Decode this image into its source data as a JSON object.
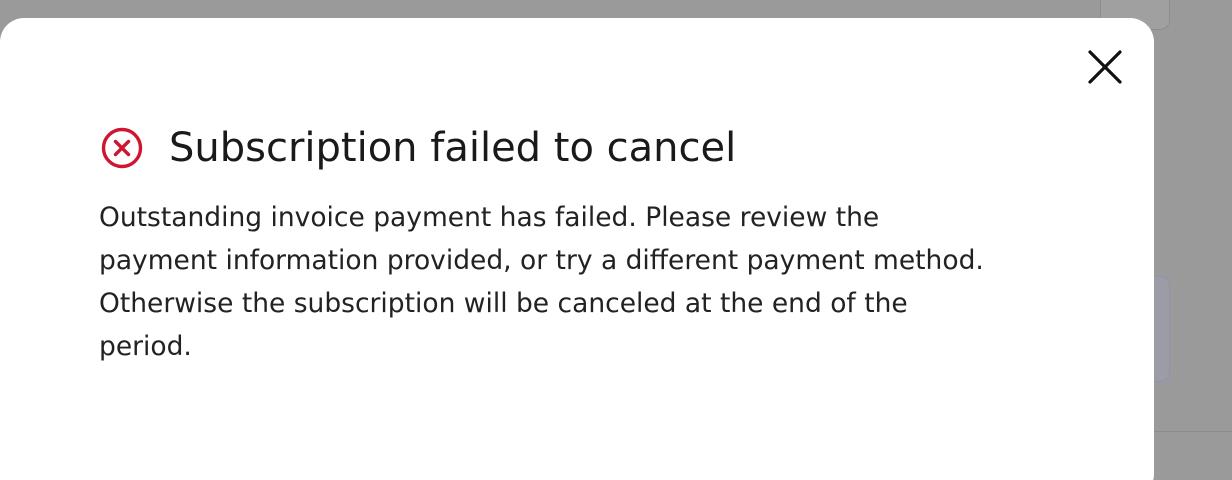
{
  "dialog": {
    "title": "Subscription failed to cancel",
    "message": "Outstanding invoice payment has failed. Please review the payment information provided, or try a different payment method. Otherwise the subscription will be canceled at the end of the period.",
    "status_icon": "error-circle-x-icon",
    "close_icon": "close-icon"
  },
  "colors": {
    "error": "#d0152f",
    "overlay": "#9a9a9a",
    "modal_background": "#ffffff",
    "text": "#222222"
  }
}
